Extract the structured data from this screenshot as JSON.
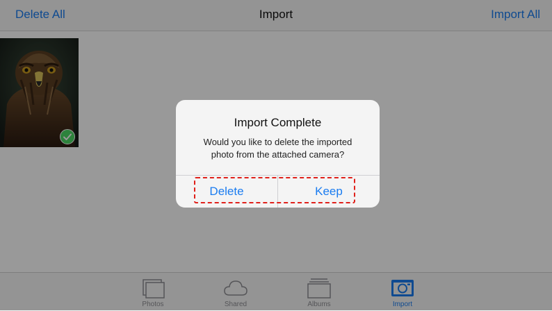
{
  "nav": {
    "left_action": "Delete All",
    "title": "Import",
    "right_action": "Import All"
  },
  "grid": {
    "items": [
      {
        "subject": "eagle",
        "selected": true
      }
    ]
  },
  "tabs": [
    {
      "label": "Photos",
      "icon": "photos-icon",
      "active": false
    },
    {
      "label": "Shared",
      "icon": "cloud-icon",
      "active": false
    },
    {
      "label": "Albums",
      "icon": "albums-icon",
      "active": false
    },
    {
      "label": "Import",
      "icon": "camera-icon",
      "active": true
    }
  ],
  "alert": {
    "title": "Import Complete",
    "message_line1": "Would you like to delete the imported",
    "message_line2": "photo from the attached camera?",
    "delete_label": "Delete",
    "keep_label": "Keep"
  },
  "colors": {
    "accent": "#1a7cf0",
    "highlight": "#e0201a",
    "check": "#4cd964",
    "inactive_tab": "#8e8e93"
  }
}
